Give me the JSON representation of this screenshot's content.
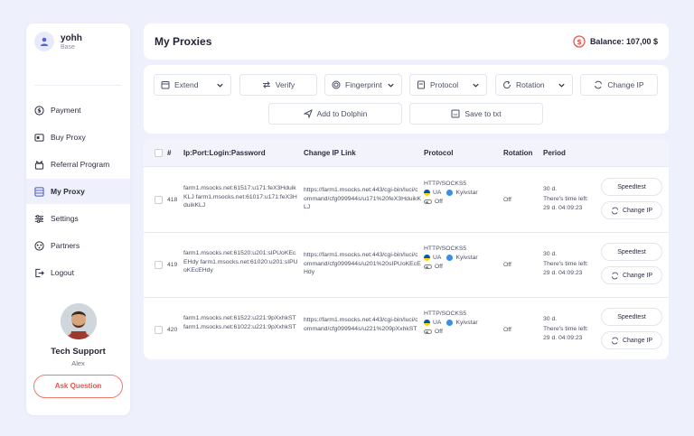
{
  "user": {
    "name": "yohh",
    "plan": "Base"
  },
  "nav": [
    {
      "label": "Payment",
      "icon": "dollar-circle-icon",
      "active": false
    },
    {
      "label": "Buy Proxy",
      "icon": "cart-icon",
      "active": false
    },
    {
      "label": "Referral Program",
      "icon": "gift-icon",
      "active": false
    },
    {
      "label": "My Proxy",
      "icon": "list-icon",
      "active": true
    },
    {
      "label": "Settings",
      "icon": "sliders-icon",
      "active": false
    },
    {
      "label": "Partners",
      "icon": "partners-icon",
      "active": false
    },
    {
      "label": "Logout",
      "icon": "logout-icon",
      "active": false
    }
  ],
  "support": {
    "name": "Tech Support",
    "person": "Alex",
    "button": "Ask Question"
  },
  "header": {
    "title": "My Proxies",
    "balance": "Balance: 107,00 $"
  },
  "toolbar": {
    "extend": "Extend",
    "verify": "Verify",
    "fingerprint": "Fingerprint",
    "protocol": "Protocol",
    "rotation": "Rotation",
    "change_ip": "Change IP",
    "add_to_dolphin": "Add to Dolphin",
    "save_to_txt": "Save to txt"
  },
  "table": {
    "columns": [
      "#",
      "Ip:Port:Login:Password",
      "Change IP Link",
      "Protocol",
      "Rotation",
      "Period"
    ],
    "rows": [
      {
        "id": "418",
        "proxy": "farm1.msocks.net:61517:u171:feX3HduikKLJ farm1.msocks.net:61017:u171:feX3HduikKLJ",
        "link": "https://farm1.msocks.net:443/cgi-bin/luci/command/cfg099944s/u171%20feX3HduikKLJ",
        "protocol": "HTTP/SOCKS5",
        "country": "UA",
        "isp": "Kyivstar",
        "switch": "Off",
        "rotation": "Off",
        "period": "30 d.",
        "left_label": "There's time left:",
        "left": "29 d. 04:09:23",
        "speedtest": "Speedtest",
        "change_ip": "Change IP"
      },
      {
        "id": "419",
        "proxy": "farm1.msocks.net:61520:u201:sIPUoKEcEHdy farm1.msocks.net:61020:u201:sIPUoKEcEHdy",
        "link": "https://farm1.msocks.net:443/cgi-bin/luci/command/cfg099944s/u201%20sIPUoKEcEHdy",
        "protocol": "HTTP/SOCKS5",
        "country": "UA",
        "isp": "Kyivstar",
        "switch": "Off",
        "rotation": "Off",
        "period": "30 d.",
        "left_label": "There's time left:",
        "left": "29 d. 04:09:23",
        "speedtest": "Speedtest",
        "change_ip": "Change IP"
      },
      {
        "id": "420",
        "proxy": "farm1.msocks.net:61522:u221:9pXxhkST farm1.msocks.net:61022:u221:9pXxhkST",
        "link": "https://farm1.msocks.net:443/cgi-bin/luci/command/cfg099944s/u221%209pXxhkST",
        "protocol": "HTTP/SOCKS5",
        "country": "UA",
        "isp": "Kyivstar",
        "switch": "Off",
        "rotation": "Off",
        "period": "30 d.",
        "left_label": "There's time left:",
        "left": "29 d. 04:09:23",
        "speedtest": "Speedtest",
        "change_ip": "Change IP"
      }
    ]
  },
  "colors": {
    "accent": "#e8554a",
    "active_bg": "#eef0fb",
    "page_bg": "#eef0fb"
  }
}
